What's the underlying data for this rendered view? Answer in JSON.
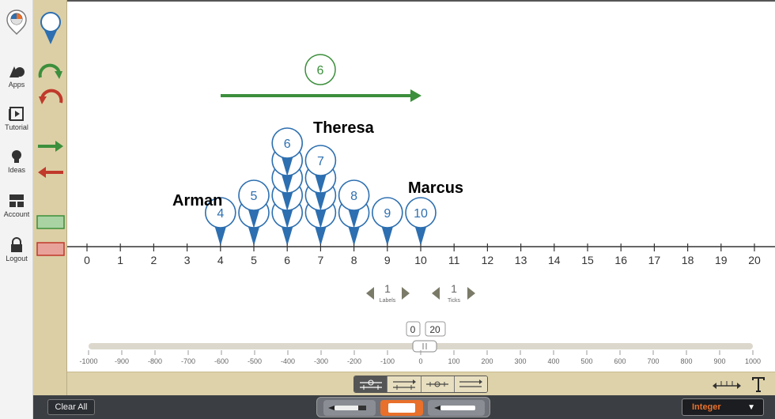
{
  "nav": {
    "apps": "Apps",
    "tutorial": "Tutorial",
    "ideas": "Ideas",
    "account": "Account",
    "logout": "Logout"
  },
  "jump_bubble": "6",
  "line": {
    "ticks": [
      "0",
      "1",
      "2",
      "3",
      "4",
      "5",
      "6",
      "7",
      "8",
      "9",
      "10",
      "11",
      "12",
      "13",
      "14",
      "15",
      "16",
      "17",
      "18",
      "19",
      "20"
    ]
  },
  "markers": [
    {
      "label": "4",
      "col": 4,
      "row": 0
    },
    {
      "label": "5",
      "col": 5,
      "row": 0
    },
    {
      "label": "5",
      "col": 5,
      "row": 1
    },
    {
      "label": "6",
      "col": 6,
      "row": 0
    },
    {
      "label": "6",
      "col": 6,
      "row": 1
    },
    {
      "label": "6",
      "col": 6,
      "row": 2
    },
    {
      "label": "6",
      "col": 6,
      "row": 3
    },
    {
      "label": "6",
      "col": 6,
      "row": 4
    },
    {
      "label": "7",
      "col": 7,
      "row": 0
    },
    {
      "label": "7",
      "col": 7,
      "row": 1
    },
    {
      "label": "7",
      "col": 7,
      "row": 2
    },
    {
      "label": "7",
      "col": 7,
      "row": 3
    },
    {
      "label": "8",
      "col": 8,
      "row": 0
    },
    {
      "label": "8",
      "col": 8,
      "row": 1
    },
    {
      "label": "9",
      "col": 9,
      "row": 0
    },
    {
      "label": "10",
      "col": 10,
      "row": 0
    }
  ],
  "names": {
    "arman": "Arman",
    "theresa": "Theresa",
    "marcus": "Marcus"
  },
  "labels_step": {
    "value": "1",
    "caption": "Labels"
  },
  "ticks_step": {
    "value": "1",
    "caption": "Ticks"
  },
  "range": {
    "min": "0",
    "max": "20"
  },
  "scroll_ticks": [
    "-1000",
    "-900",
    "-800",
    "-700",
    "-600",
    "-500",
    "-400",
    "-300",
    "-200",
    "-100",
    "0",
    "100",
    "200",
    "300",
    "400",
    "500",
    "600",
    "700",
    "800",
    "900",
    "1000"
  ],
  "footer": {
    "clear": "Clear All",
    "mode": "Integer"
  },
  "colors": {
    "marker_blue": "#2d6fb0",
    "jump_green": "#3c8f3c",
    "jump_red": "#c0392b",
    "palette_bg": "#dccfa6"
  }
}
